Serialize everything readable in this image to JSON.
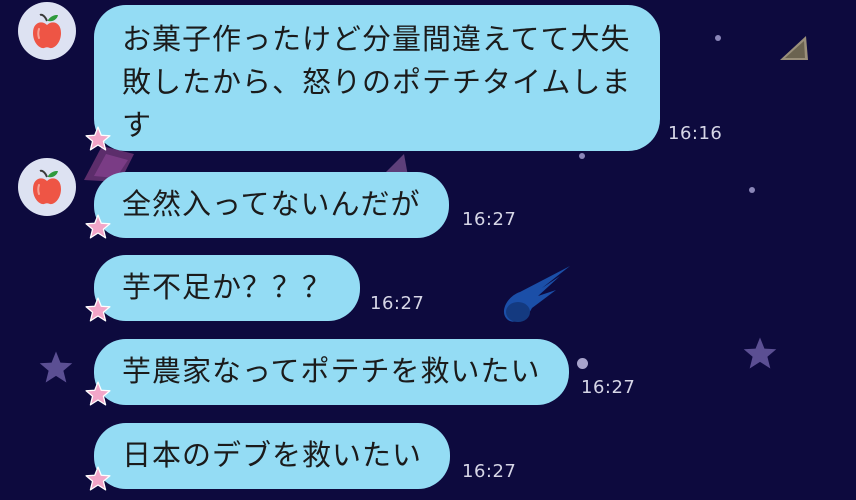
{
  "messages": [
    {
      "text": "お菓子作ったけど分量間違えてて大失敗したから、怒りのポテチタイムします",
      "time": "16:16"
    },
    {
      "text": "全然入ってないんだが",
      "time": "16:27"
    },
    {
      "text": "芋不足か？？？",
      "time": "16:27"
    },
    {
      "text": "芋農家なってポテチを救いたい",
      "time": "16:27"
    },
    {
      "text": "日本のデブを救いたい",
      "time": "16:27"
    }
  ],
  "icons": {
    "avatar": "apple-icon",
    "decoration": [
      "star-icon",
      "comet-icon",
      "asteroid-icon"
    ]
  },
  "colors": {
    "background": "#0d0a3e",
    "bubble": "#94dcf4",
    "star_pink": "#f2a6c8",
    "star_purple": "#5b4f93",
    "comet": "#1b4fa8"
  }
}
